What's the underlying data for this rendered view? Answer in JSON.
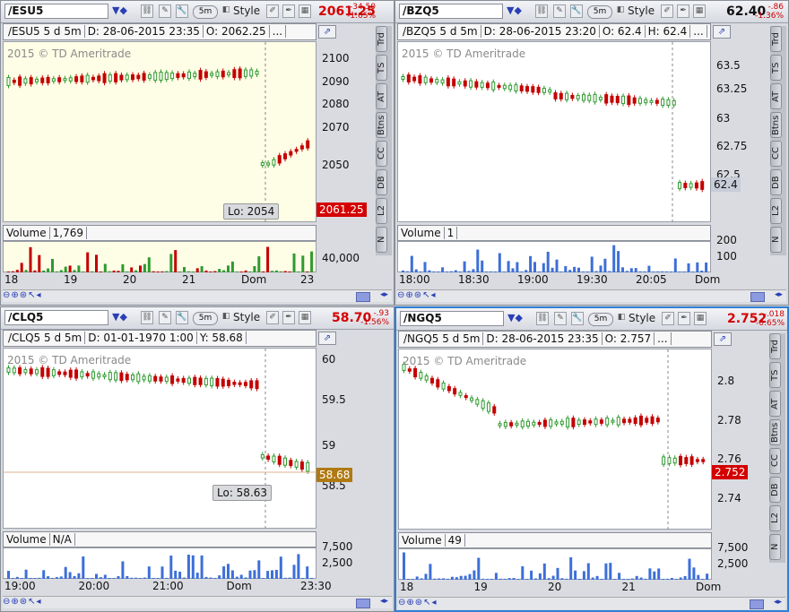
{
  "panels": [
    {
      "symbol": "/ESU5",
      "price": "2061.25",
      "price_color": "#d40000",
      "change": "-34.50",
      "change_pct": "-1.65%",
      "info": [
        "/ESU5 5 d 5m",
        "D: 28-06-2015 23:35",
        "O: 2062.25",
        "..."
      ],
      "watermark": "2015 © TD Ameritrade",
      "y_ticks": [
        "2100",
        "2090",
        "2080",
        "2070",
        "2050"
      ],
      "price_label": "2061.25",
      "lo_label": "Lo: 2054",
      "bg": "#fefde6",
      "volume": [
        "Volume",
        "1,769"
      ],
      "vol_ticks": [
        "40,000"
      ],
      "x_ticks": [
        "18",
        "19",
        "20",
        "21",
        "Dom",
        "23"
      ],
      "interval": "5m",
      "style_label": "Style",
      "side_tabs": [
        "Trd",
        "TS",
        "AT",
        "Btns",
        "CC",
        "DB",
        "L2",
        "N"
      ]
    },
    {
      "symbol": "/BZQ5",
      "price": "62.40",
      "price_color": "#111111",
      "change": "-.86",
      "change_pct": "-1.36%",
      "info": [
        "/BZQ5 5 d 5m",
        "D: 28-06-2015 23:20",
        "O: 62.4",
        "H: 62.4",
        "..."
      ],
      "watermark": "2015 © TD Ameritrade",
      "y_ticks": [
        "63.5",
        "63.25",
        "63",
        "62.75",
        "62.5"
      ],
      "price_label": "62.4",
      "lo_label": "",
      "bg": "#ffffff",
      "volume": [
        "Volume",
        "1"
      ],
      "vol_ticks": [
        "200",
        "100"
      ],
      "x_ticks": [
        "18:00",
        "18:30",
        "19:00",
        "19:30",
        "20:05",
        "Dom"
      ],
      "interval": "5m",
      "style_label": "Style",
      "side_tabs": [
        "Trd",
        "TS",
        "AT",
        "Btns",
        "CC",
        "DB",
        "L2",
        "N"
      ]
    },
    {
      "symbol": "/CLQ5",
      "price": "58.70",
      "price_color": "#d40000",
      "change": "-.93",
      "change_pct": "-1.56%",
      "info": [
        "/CLQ5 5 d 5m",
        "D: 01-01-1970 1:00",
        "Y: 58.68"
      ],
      "watermark": "2015 © TD Ameritrade",
      "y_ticks": [
        "60",
        "59.5",
        "59",
        "58.5"
      ],
      "price_label": "58.68",
      "lo_label": "Lo: 58.63",
      "bg": "#ffffff",
      "volume": [
        "Volume",
        "N/A"
      ],
      "vol_ticks": [
        "7,500",
        "2,500"
      ],
      "x_ticks": [
        "19:00",
        "20:00",
        "21:00",
        "Dom",
        "23:30"
      ],
      "interval": "5m",
      "style_label": "Style",
      "side_tabs": []
    },
    {
      "symbol": "/NGQ5",
      "price": "2.752",
      "price_color": "#d40000",
      "change": "-.018",
      "change_pct": "-0.65%",
      "info": [
        "/NGQ5 5 d 5m",
        "D: 28-06-2015 23:35",
        "O: 2.757",
        "..."
      ],
      "watermark": "2015 © TD Ameritrade",
      "y_ticks": [
        "2.8",
        "2.78",
        "2.76",
        "2.74"
      ],
      "price_label": "2.752",
      "lo_label": "",
      "bg": "#ffffff",
      "volume": [
        "Volume",
        "49"
      ],
      "vol_ticks": [
        "7,500",
        "2,500"
      ],
      "x_ticks": [
        "18",
        "19",
        "20",
        "21",
        "Dom"
      ],
      "interval": "5m",
      "style_label": "Style",
      "side_tabs": [
        "Trd",
        "TS",
        "AT",
        "Btns",
        "CC",
        "DB",
        "L2",
        "N"
      ]
    }
  ],
  "colors": {
    "up": "#2f9a2f",
    "down": "#c40000",
    "volume": "#3d6fd8",
    "accent": "#2f7fd6"
  }
}
